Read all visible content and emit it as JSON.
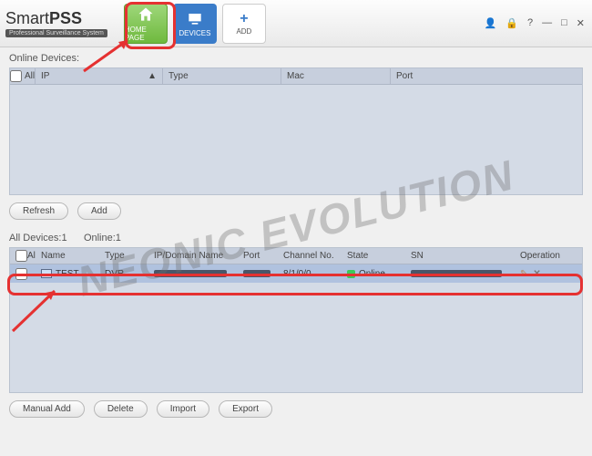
{
  "app": {
    "brand_light": "Smart",
    "brand_bold": "PSS",
    "subtitle": "Professional Surveillance System"
  },
  "tabs": {
    "home": "HOME PAGE",
    "devices": "DEVICES",
    "add": "ADD"
  },
  "online": {
    "label": "Online Devices:",
    "cols": {
      "all": "All",
      "ip": "IP",
      "type": "Type",
      "mac": "Mac",
      "port": "Port"
    }
  },
  "buttons": {
    "refresh": "Refresh",
    "add": "Add",
    "manual_add": "Manual Add",
    "delete": "Delete",
    "import": "Import",
    "export": "Export"
  },
  "all_devices": {
    "summary_devices_label": "All Devices:",
    "summary_devices_count": "1",
    "summary_online_label": "Online:",
    "summary_online_count": "1",
    "cols": {
      "all": "All",
      "name": "Name",
      "type": "Type",
      "ip": "IP/Domain Name",
      "port": "Port",
      "channel": "Channel No.",
      "state": "State",
      "sn": "SN",
      "op": "Operation"
    },
    "row": {
      "name": "TEST",
      "type": "DVR",
      "channel": "8/1/0/0",
      "state": "Online"
    }
  },
  "watermark": "NEONIC EVOLUTION"
}
